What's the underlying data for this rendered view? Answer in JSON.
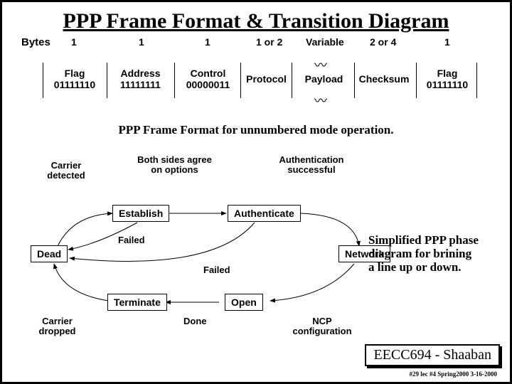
{
  "title": "PPP Frame Format & Transition Diagram",
  "frame": {
    "bytes_label": "Bytes",
    "fields": [
      {
        "bytes": "1",
        "name": "Flag",
        "value": "01111110"
      },
      {
        "bytes": "1",
        "name": "Address",
        "value": "11111111"
      },
      {
        "bytes": "1",
        "name": "Control",
        "value": "00000011"
      },
      {
        "bytes": "1 or 2",
        "name": "Protocol",
        "value": ""
      },
      {
        "bytes": "Variable",
        "name": "Payload",
        "value": ""
      },
      {
        "bytes": "2 or 4",
        "name": "Checksum",
        "value": ""
      },
      {
        "bytes": "1",
        "name": "Flag",
        "value": "01111110"
      }
    ]
  },
  "caption1": "PPP Frame Format for unnumbered mode operation.",
  "state_diagram": {
    "states": [
      "Dead",
      "Establish",
      "Authenticate",
      "Network",
      "Open",
      "Terminate"
    ],
    "transitions": {
      "carrier_detected": "Carrier detected",
      "both_sides_agree": "Both sides agree on options",
      "auth_success": "Authentication successful",
      "failed1": "Failed",
      "failed2": "Failed",
      "carrier_dropped": "Carrier dropped",
      "done": "Done",
      "ncp_config": "NCP configuration"
    }
  },
  "caption2_line1": "Simplified PPP phase",
  "caption2_line2": "diagram for brining",
  "caption2_line3": "a line up or down.",
  "footer_course": "EECC694 - Shaaban",
  "footer_small": "#29 lec #4  Spring2000  3-16-2000"
}
